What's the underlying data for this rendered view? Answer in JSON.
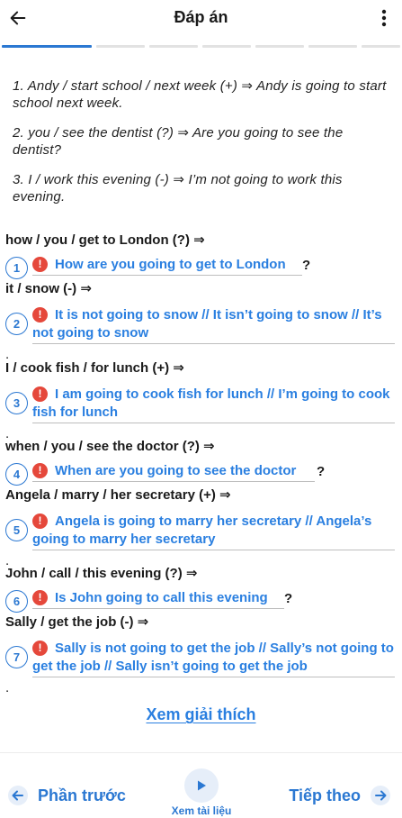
{
  "header": {
    "title": "Đáp án",
    "back_icon": "arrow-left-icon",
    "more_icon": "more-vertical-icon"
  },
  "progress": {
    "total_segments": 8,
    "active_segments": 2
  },
  "prompts": [
    "1. Andy / start school / next week (+) ⇒ Andy is going to start school next week.",
    "2. you / see the dentist (?) ⇒ Are you going to see the dentist?",
    "3. I / work this evening (-) ⇒ I’m not going to work this evening."
  ],
  "questions": [
    {
      "label": "how / you / get to London (?) ⇒",
      "number": "1",
      "answer": "How are you going to get to London",
      "suffix": "?"
    },
    {
      "label": "it / snow (-) ⇒",
      "number": "2",
      "answer": "It is not going to snow // It isn’t going to snow // It’s not going to snow",
      "suffix": "."
    },
    {
      "label": "I / cook fish / for lunch (+) ⇒",
      "number": "3",
      "answer": "I am going to cook fish for lunch // I’m going to cook fish for lunch",
      "suffix": "."
    },
    {
      "label": "when / you / see the doctor (?) ⇒",
      "number": "4",
      "answer": "When are you going to see the doctor",
      "suffix": "?"
    },
    {
      "label": "Angela / marry / her secretary (+) ⇒",
      "number": "5",
      "answer": "Angela is going to marry her secretary // Angela’s going to marry her secretary",
      "suffix": "."
    },
    {
      "label": "John / call / this evening (?) ⇒",
      "number": "6",
      "answer": "Is John going to call this evening",
      "suffix": "?"
    },
    {
      "label": "Sally / get the job (-) ⇒",
      "number": "7",
      "answer": "Sally is not going to get the job // Sally’s not going to get the job // Sally isn’t going to get the job",
      "suffix": "."
    }
  ],
  "error_icon": "error-icon",
  "explain_link": "Xem giải thích",
  "footer": {
    "prev_label": "Phần trước",
    "next_label": "Tiếp theo",
    "material_label": "Xem tài liệu",
    "play_icon": "play-icon"
  },
  "colors": {
    "accent": "#2b78d2",
    "answer_text": "#2a7fe0",
    "error": "#e5483b"
  }
}
